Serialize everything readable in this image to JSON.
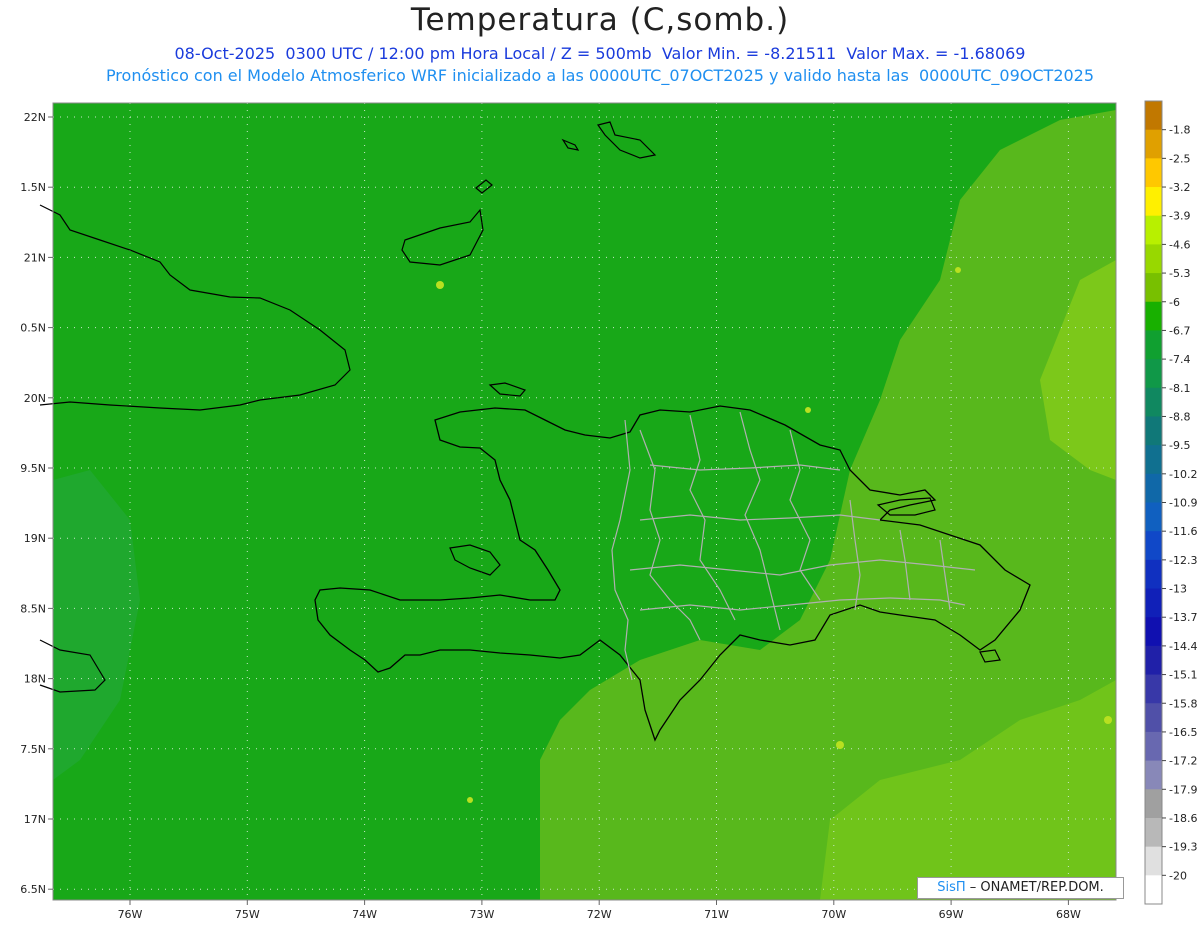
{
  "title": "Temperatura (C,somb.)",
  "subtitle_line1": "08-Oct-2025  0300 UTC / 12:00 pm Hora Local / Z = 500mb  Valor Min. = -8.21511  Valor Max. = -1.68069",
  "subtitle_line2": "Pronóstico con el Modelo Atmosferico WRF inicializado a las 0000UTC_07OCT2025 y valido hasta las  0000UTC_09OCT2025",
  "credit": {
    "sis": "SisΠ",
    "org": "– ONAMET/REP.DOM."
  },
  "axes": {
    "lat_labels": [
      "22N",
      "1.5N",
      "21N",
      "0.5N",
      "20N",
      "9.5N",
      "19N",
      "8.5N",
      "18N",
      "7.5N",
      "17N",
      "6.5N"
    ],
    "lon_labels": [
      "76W",
      "75W",
      "74W",
      "73W",
      "72W",
      "71W",
      "70W",
      "69W",
      "68W"
    ]
  },
  "colorbar": {
    "labels": [
      "-1.8",
      "-2.5",
      "-3.2",
      "-3.9",
      "-4.6",
      "-5.3",
      "-6",
      "-6.7",
      "-7.4",
      "-8.1",
      "-8.8",
      "-9.5",
      "-10.2",
      "-10.9",
      "-11.6",
      "-12.3",
      "-13",
      "-13.7",
      "-14.4",
      "-15.1",
      "-15.8",
      "-16.5",
      "-17.2",
      "-17.9",
      "-18.6",
      "-19.3",
      "-20"
    ],
    "colors": [
      "#c17800",
      "#e0a000",
      "#ffc800",
      "#fff000",
      "#b8f000",
      "#98d800",
      "#78c000",
      "#18b000",
      "#10a030",
      "#109848",
      "#108860",
      "#107878",
      "#107090",
      "#1068a8",
      "#1060c0",
      "#1048c8",
      "#1030c0",
      "#1020b8",
      "#1010b0",
      "#2020a8",
      "#3838a8",
      "#5050a8",
      "#6868b0",
      "#8888b8",
      "#a0a0a0",
      "#b8b8b8",
      "#e0e0e0",
      "#ffffff"
    ]
  },
  "colors": {
    "background_field": "#18a818",
    "warm_field": "#6cc01c",
    "coast": "#000000",
    "provinces": "#b0b0b0"
  }
}
